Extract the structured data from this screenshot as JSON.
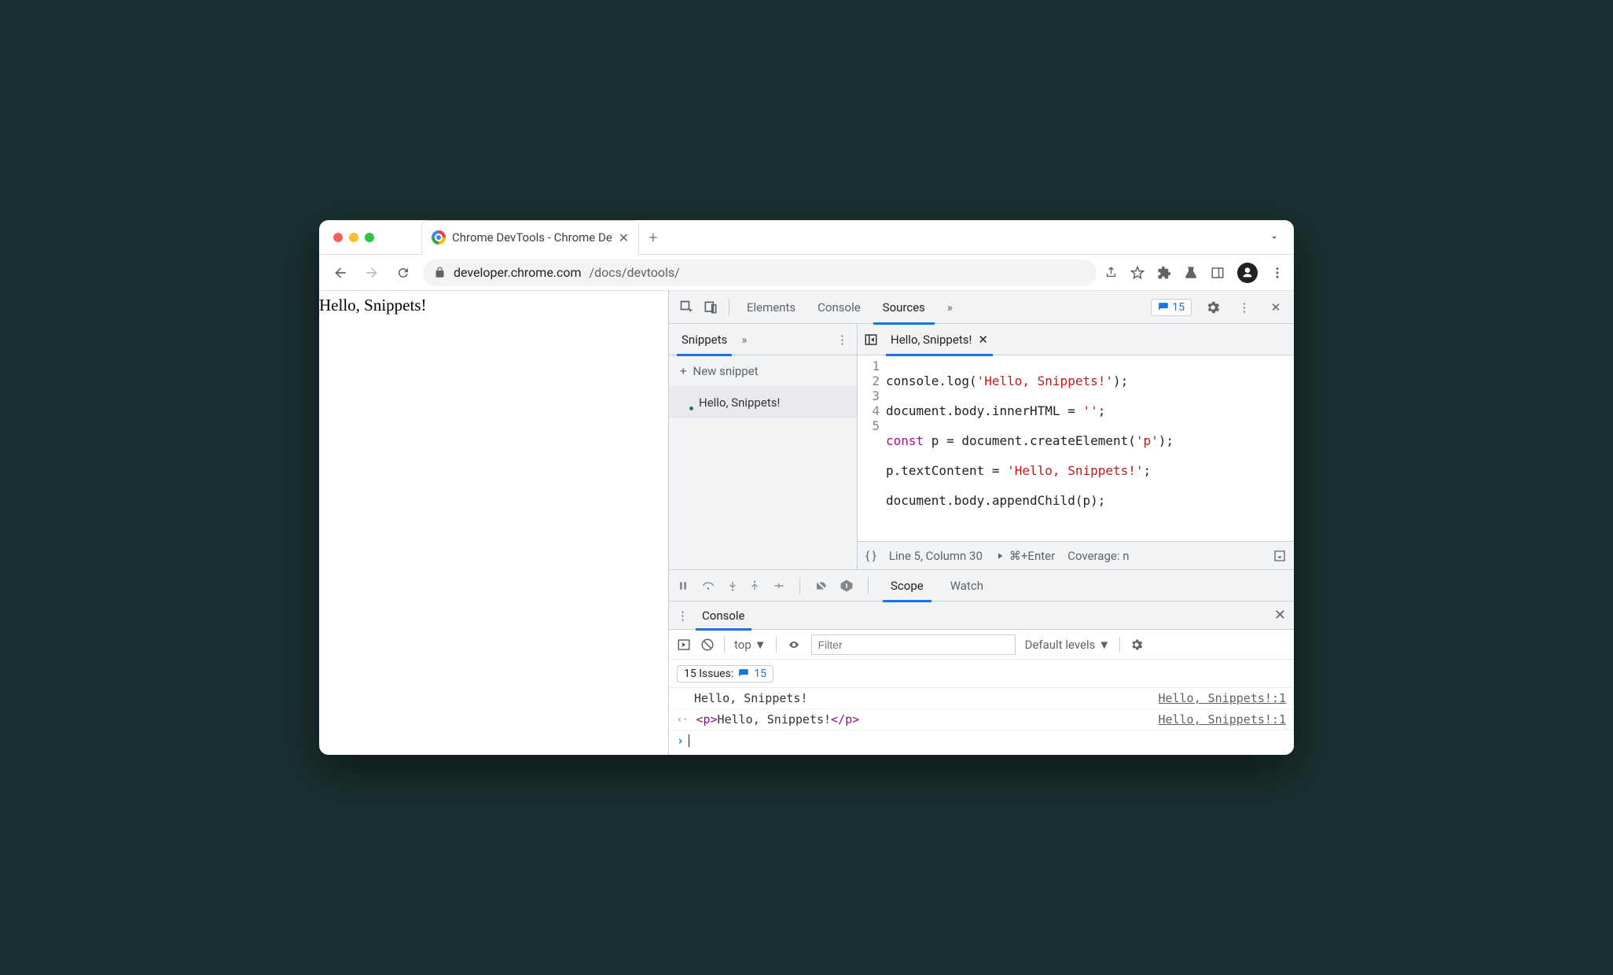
{
  "browser": {
    "tab_title": "Chrome DevTools - Chrome De",
    "url_host": "developer.chrome.com",
    "url_path": "/docs/devtools/"
  },
  "page": {
    "body_text": "Hello, Snippets!"
  },
  "devtools": {
    "tabs": {
      "elements": "Elements",
      "console": "Console",
      "sources": "Sources"
    },
    "issues_count": "15",
    "left": {
      "snippets_tab": "Snippets",
      "new_snippet": "New snippet",
      "snippet_name": "Hello, Snippets!"
    },
    "editor": {
      "file_tab": "Hello, Snippets!",
      "lines": [
        {
          "n": "1",
          "pre": "console.log(",
          "str": "'Hello, Snippets!'",
          "post": ");"
        },
        {
          "n": "2",
          "pre": "document.body.innerHTML = ",
          "str": "''",
          "post": ";"
        },
        {
          "n": "3",
          "kw": "const",
          "mid": " p = document.createElement(",
          "str": "'p'",
          "post": ");"
        },
        {
          "n": "4",
          "pre": "p.textContent = ",
          "str": "'Hello, Snippets!'",
          "post": ";"
        },
        {
          "n": "5",
          "pre": "document.body.appendChild(p);",
          "str": "",
          "post": ""
        }
      ],
      "status_line": "Line 5, Column 30",
      "status_run": "⌘+Enter",
      "status_coverage": "Coverage: n"
    },
    "debug": {
      "scope": "Scope",
      "watch": "Watch"
    },
    "console": {
      "tab": "Console",
      "context": "top",
      "filter_placeholder": "Filter",
      "levels": "Default levels",
      "issues_label": "15 Issues:",
      "issues_count": "15",
      "rows": [
        {
          "msg": "Hello, Snippets!",
          "src": "Hello, Snippets!:1"
        },
        {
          "html_open": "<p>",
          "html_text": "Hello, Snippets!",
          "html_close": "</p>",
          "src": "Hello, Snippets!:1"
        }
      ]
    }
  }
}
